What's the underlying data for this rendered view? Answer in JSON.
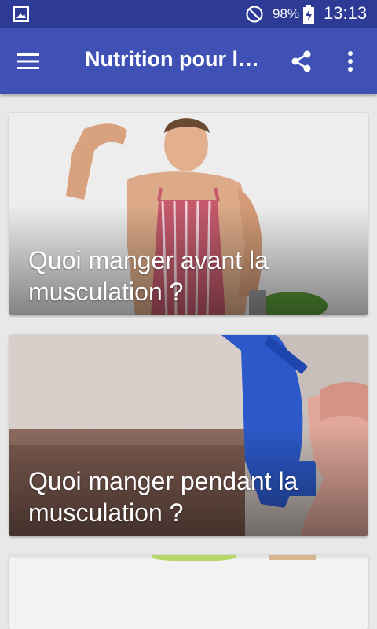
{
  "status_bar": {
    "battery_percent": "98%",
    "time": "13:13",
    "icons": [
      "gallery-icon",
      "do-not-disturb-icon",
      "battery-charging-icon"
    ]
  },
  "app_bar": {
    "title": "Nutrition pour la musculation",
    "icons": [
      "menu-icon",
      "share-icon",
      "more-vert-icon"
    ]
  },
  "articles": [
    {
      "caption": "Quoi manger avant la musculation ?"
    },
    {
      "caption": "Quoi manger pendant la musculation ?"
    }
  ],
  "colors": {
    "status_bar": "#2d3b96",
    "app_bar": "#3f51b5",
    "background": "#e8e8e8"
  }
}
